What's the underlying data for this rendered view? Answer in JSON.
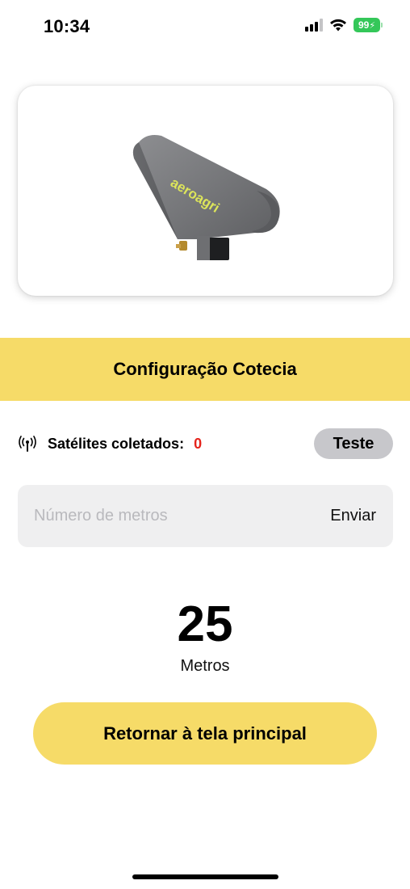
{
  "status_bar": {
    "time": "10:34",
    "battery_level": "99",
    "battery_color": "#34c759",
    "icons": [
      "cellular-signal-icon",
      "wifi-icon",
      "battery-charging-icon"
    ]
  },
  "product": {
    "image_name": "aeroagri-device-image",
    "brand_text": "aeroagri"
  },
  "config": {
    "title": "Configuração Cotecia"
  },
  "satellites": {
    "icon": "antenna-icon",
    "label": "Satélites coletados:",
    "count": "0",
    "count_color": "#e5241c",
    "test_button_label": "Teste"
  },
  "meters_input": {
    "placeholder": "Número de metros",
    "value": "",
    "send_label": "Enviar"
  },
  "meters_display": {
    "value": "25",
    "unit": "Metros"
  },
  "return_button": {
    "label": "Retornar à tela principal"
  },
  "colors": {
    "accent": "#f6db68",
    "button_gray": "#c7c7cb",
    "field_bg": "#efeff0"
  }
}
